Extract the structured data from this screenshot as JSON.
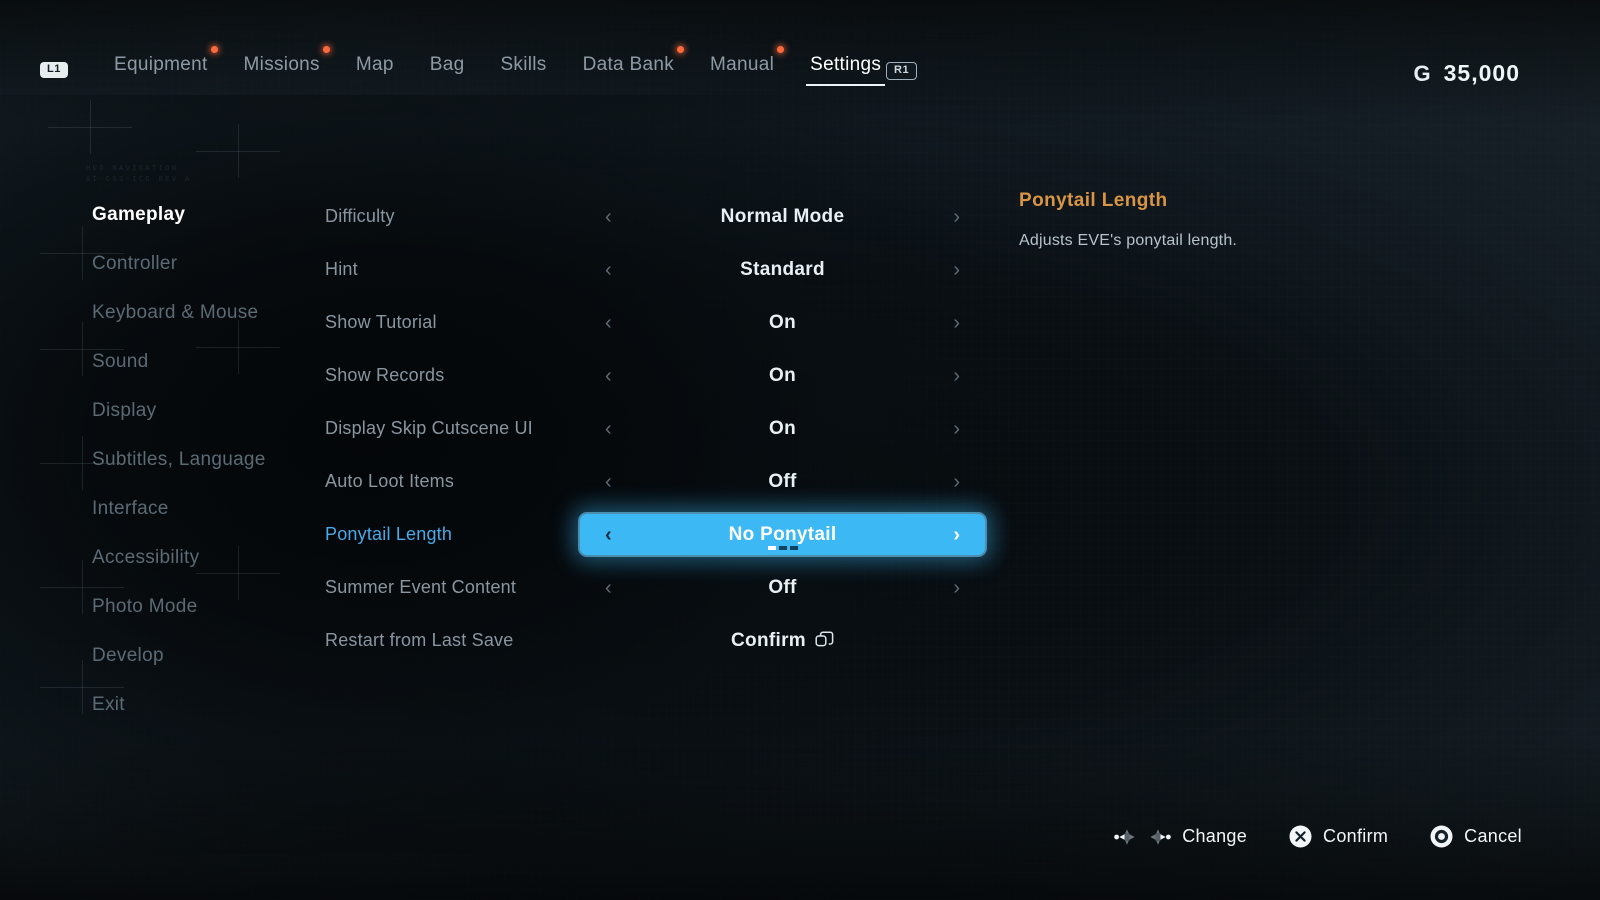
{
  "window": {
    "title": "Settings"
  },
  "topnav": {
    "bumper_left": "L1",
    "bumper_right": "R1",
    "tabs": [
      {
        "label": "Equipment",
        "active": false,
        "dot": true
      },
      {
        "label": "Missions",
        "active": false,
        "dot": true
      },
      {
        "label": "Map",
        "active": false,
        "dot": false
      },
      {
        "label": "Bag",
        "active": false,
        "dot": false
      },
      {
        "label": "Skills",
        "active": false,
        "dot": false
      },
      {
        "label": "Data Bank",
        "active": false,
        "dot": true
      },
      {
        "label": "Manual",
        "active": false,
        "dot": true
      },
      {
        "label": "Settings",
        "active": true,
        "dot": false
      }
    ]
  },
  "currency": {
    "symbol": "G",
    "amount": "35,000"
  },
  "decor": {
    "hud_text": "HUD NAVIGATION\nAI-CSS-ICO REV A"
  },
  "sidebar": {
    "items": [
      {
        "label": "Gameplay",
        "active": true
      },
      {
        "label": "Controller",
        "active": false
      },
      {
        "label": "Keyboard & Mouse",
        "active": false
      },
      {
        "label": "Sound",
        "active": false
      },
      {
        "label": "Display",
        "active": false
      },
      {
        "label": "Subtitles, Language",
        "active": false
      },
      {
        "label": "Interface",
        "active": false
      },
      {
        "label": "Accessibility",
        "active": false
      },
      {
        "label": "Photo Mode",
        "active": false
      },
      {
        "label": "Develop",
        "active": false
      },
      {
        "label": "Exit",
        "active": false
      }
    ]
  },
  "settings": {
    "rows": [
      {
        "label": "Difficulty",
        "value": "Normal Mode",
        "type": "stepper",
        "selected": false
      },
      {
        "label": "Hint",
        "value": "Standard",
        "type": "stepper",
        "selected": false
      },
      {
        "label": "Show Tutorial",
        "value": "On",
        "type": "stepper",
        "selected": false
      },
      {
        "label": "Show Records",
        "value": "On",
        "type": "stepper",
        "selected": false
      },
      {
        "label": "Display Skip Cutscene UI",
        "value": "On",
        "type": "stepper",
        "selected": false
      },
      {
        "label": "Auto Loot Items",
        "value": "Off",
        "type": "stepper",
        "selected": false
      },
      {
        "label": "Ponytail Length",
        "value": "No Ponytail",
        "type": "stepper",
        "selected": true,
        "steps": 3,
        "step_active": 1
      },
      {
        "label": "Summer Event Content",
        "value": "Off",
        "type": "stepper",
        "selected": false
      },
      {
        "label": "Restart from Last Save",
        "value": "Confirm",
        "type": "action",
        "selected": false,
        "icon": "windows-icon"
      }
    ],
    "chevron_left": "‹",
    "chevron_right": "›"
  },
  "info": {
    "title": "Ponytail Length",
    "description": "Adjusts EVE's ponytail length."
  },
  "hints": [
    {
      "label": "Change",
      "icon": "dpad-left-right-icon"
    },
    {
      "label": "Confirm",
      "icon": "cross-button-icon"
    },
    {
      "label": "Cancel",
      "icon": "circle-button-icon"
    }
  ],
  "colors": {
    "accent_blue": "#3cb8f5",
    "accent_orange": "#d99544",
    "notification_dot": "#ff6a3d",
    "bg_dark": "#0d1419",
    "bg_slate": "#24323c"
  }
}
